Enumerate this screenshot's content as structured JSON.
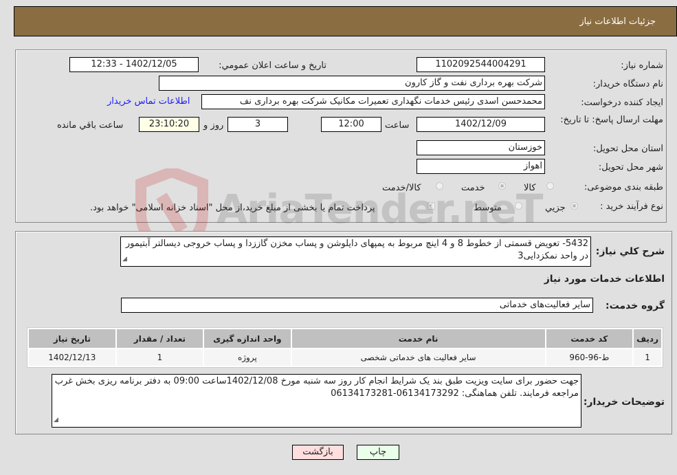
{
  "header": {
    "title": "جزئیات اطلاعات نیاز"
  },
  "fields": {
    "need_number": {
      "label": "شماره نیاز:",
      "value": "1102092544004291"
    },
    "announce_datetime": {
      "label": "تاريخ و ساعت اعلان عمومي:",
      "value": "1402/12/05 - 12:33"
    },
    "buyer_org": {
      "label": "نام دستگاه خريدار:",
      "value": "شرکت بهره برداری نفت و گاز کارون"
    },
    "requester": {
      "label": "ايجاد کننده درخواست:",
      "value": "محمدحسن اسدی رئیس خدمات نگهداری تعمیرات مکانیک شرکت بهره برداری نف"
    },
    "buyer_contact_link": "اطلاعات تماس خريدار",
    "deadline": {
      "label": "مهلت ارسال پاسخ: تا تاريخ:",
      "date": "1402/12/09",
      "time_label": "ساعت",
      "time": "12:00",
      "days": "3",
      "days_label": "روز و",
      "remaining": "23:10:20",
      "remaining_label": "ساعت باقي مانده"
    },
    "province": {
      "label": "استان محل تحویل:",
      "value": "خوزستان"
    },
    "city": {
      "label": "شهر محل تحویل:",
      "value": "اهواز"
    },
    "category": {
      "label": "طبقه بندی موضوعی:",
      "options": [
        "کالا",
        "خدمت",
        "کالا/خدمت"
      ],
      "selected": "خدمت"
    },
    "purchase_type": {
      "label": "نوع فرآيند خريد :",
      "options": [
        "جزيي",
        "متوسط"
      ],
      "selected": "جزيي",
      "treasury_note": "پرداخت تمام یا بخشی از مبلغ خرید،از محل \"اسناد خزانه اسلامی\" خواهد بود."
    }
  },
  "description": {
    "label": "شرح کلي نياز:",
    "value": "5432- تعویض قسمتی از خطوط 8 و 4 اینچ مربوط به پمپهای دایلوشن و پساب مخزن گاززدا و پساب خروجی دیسالتر آبتیمور در واحد نمکزدایی3"
  },
  "services_section": {
    "title": "اطلاعات خدمات مورد نياز",
    "group_label": "گروه خدمت:",
    "group_value": "سایر فعالیت‌های خدماتی"
  },
  "table": {
    "headers": [
      "رديف",
      "کد خدمت",
      "نام خدمت",
      "واحد اندازه گیری",
      "تعداد / مقدار",
      "تاريخ نياز"
    ],
    "rows": [
      [
        "1",
        "ط-96-960",
        "سایر فعالیت های خدماتی شخصی",
        "پروژه",
        "1",
        "1402/12/13"
      ]
    ]
  },
  "buyer_notes": {
    "label": "توضيحات خريدار:",
    "value": "جهت حضور برای سایت ویزیت طبق بند یک شرایط انجام کار روز سه شنبه مورخ  1402/12/08ساعت 09:00 به دفتر برنامه ریزی بخش غرب مراجعه فرمایند. تلفن هماهنگی: 06134173292-06134173281"
  },
  "buttons": {
    "print": "چاپ",
    "back": "بازگشت"
  },
  "watermark": "AriaTender.neT"
}
